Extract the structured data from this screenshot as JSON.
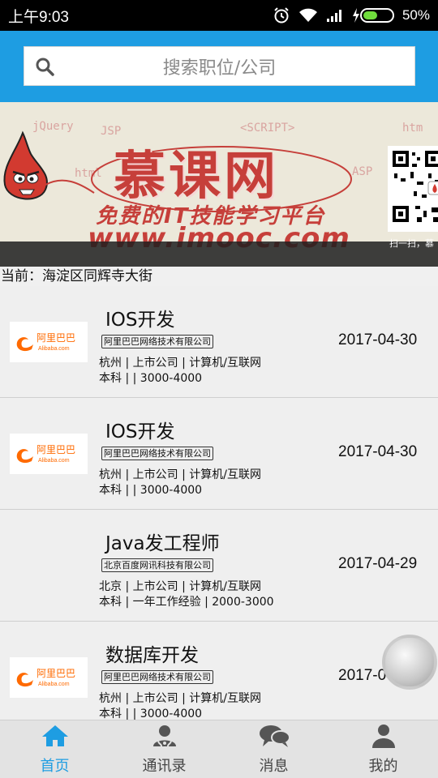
{
  "status_bar": {
    "time": "上午9:03",
    "battery_percent_text": "50%",
    "battery_level": 0.5
  },
  "search": {
    "placeholder": "搜索职位/公司"
  },
  "banner": {
    "brand_text": "慕课网",
    "slogan": "免费的IT技能学习平台",
    "url": "www.imooc.com",
    "qr_caption": "扫一扫，慕",
    "bg_words": [
      "jQuery",
      "JSP",
      "<SCRIPT>",
      "htm",
      "html",
      "ASP"
    ]
  },
  "location": {
    "text": "当前：海淀区同辉寺大街"
  },
  "jobs": [
    {
      "title": "IOS开发",
      "company": "阿里巴巴网络技术有限公司",
      "meta1": "杭州 | 上市公司 | 计算机/互联网",
      "meta2": "本科 |  | 3000-4000",
      "date": "2017-04-30",
      "logo": "alibaba"
    },
    {
      "title": "IOS开发",
      "company": "阿里巴巴网络技术有限公司",
      "meta1": "杭州 | 上市公司 | 计算机/互联网",
      "meta2": "本科 |  | 3000-4000",
      "date": "2017-04-30",
      "logo": "alibaba"
    },
    {
      "title": "Java发工程师",
      "company": "北京百度网讯科技有限公司",
      "meta1": "北京 | 上市公司 | 计算机/互联网",
      "meta2": "本科 | 一年工作经验 | 2000-3000",
      "date": "2017-04-29",
      "logo": ""
    },
    {
      "title": "数据库开发",
      "company": "阿里巴巴网络技术有限公司",
      "meta1": "杭州 | 上市公司 | 计算机/互联网",
      "meta2": "本科 |  | 3000-4000",
      "date": "2017-04-30",
      "logo": "alibaba"
    }
  ],
  "bottom_nav": [
    {
      "label": "首页",
      "icon": "home-icon",
      "active": true
    },
    {
      "label": "通讯录",
      "icon": "contacts-icon",
      "active": false
    },
    {
      "label": "消息",
      "icon": "message-icon",
      "active": false
    },
    {
      "label": "我的",
      "icon": "user-icon",
      "active": false
    }
  ],
  "colors": {
    "accent": "#1e9de2",
    "brand_red": "#c63f3a",
    "alibaba_orange": "#ff6a00"
  }
}
